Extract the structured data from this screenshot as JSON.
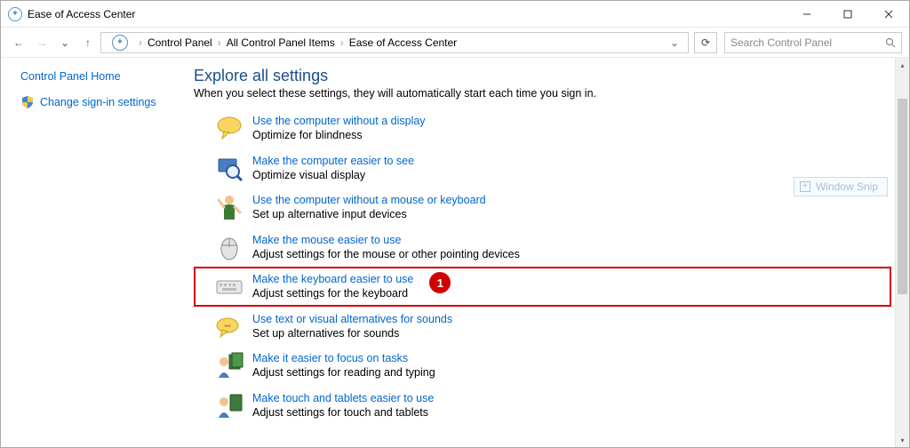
{
  "window": {
    "title": "Ease of Access Center"
  },
  "address": {
    "crumb1": "Control Panel",
    "crumb2": "All Control Panel Items",
    "crumb3": "Ease of Access Center",
    "search_placeholder": "Search Control Panel"
  },
  "sidebar": {
    "home": "Control Panel Home",
    "signin": "Change sign-in settings"
  },
  "content": {
    "heading": "Explore all settings",
    "subtitle": "When you select these settings, they will automatically start each time you sign in.",
    "options": [
      {
        "link": "Use the computer without a display",
        "desc": "Optimize for blindness"
      },
      {
        "link": "Make the computer easier to see",
        "desc": "Optimize visual display"
      },
      {
        "link": "Use the computer without a mouse or keyboard",
        "desc": "Set up alternative input devices"
      },
      {
        "link": "Make the mouse easier to use",
        "desc": "Adjust settings for the mouse or other pointing devices"
      },
      {
        "link": "Make the keyboard easier to use",
        "desc": "Adjust settings for the keyboard"
      },
      {
        "link": "Use text or visual alternatives for sounds",
        "desc": "Set up alternatives for sounds"
      },
      {
        "link": "Make it easier to focus on tasks",
        "desc": "Adjust settings for reading and typing"
      },
      {
        "link": "Make touch and tablets easier to use",
        "desc": "Adjust settings for touch and tablets"
      }
    ]
  },
  "annotation": {
    "badge": "1"
  },
  "snip": {
    "label": "Window Snip"
  }
}
